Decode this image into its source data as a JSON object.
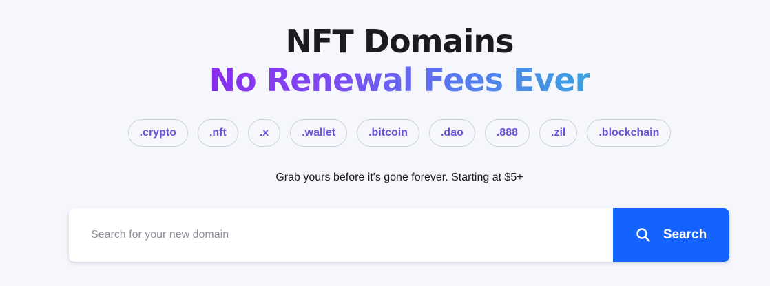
{
  "hero": {
    "title": "NFT Domains",
    "subtitle": "No Renewal Fees Ever",
    "tagline": "Grab yours before it's gone forever. Starting at $5+"
  },
  "tlds": [
    ".crypto",
    ".nft",
    ".x",
    ".wallet",
    ".bitcoin",
    ".dao",
    ".888",
    ".zil",
    ".blockchain"
  ],
  "search": {
    "placeholder": "Search for your new domain",
    "value": "",
    "button_label": "Search",
    "button_icon": "search-icon"
  },
  "colors": {
    "background": "#f6f7fd",
    "accent_button": "#1463ff",
    "chip_text": "#6a51d8",
    "gradient_start": "#8b2cf0",
    "gradient_end": "#3aa2e2"
  }
}
